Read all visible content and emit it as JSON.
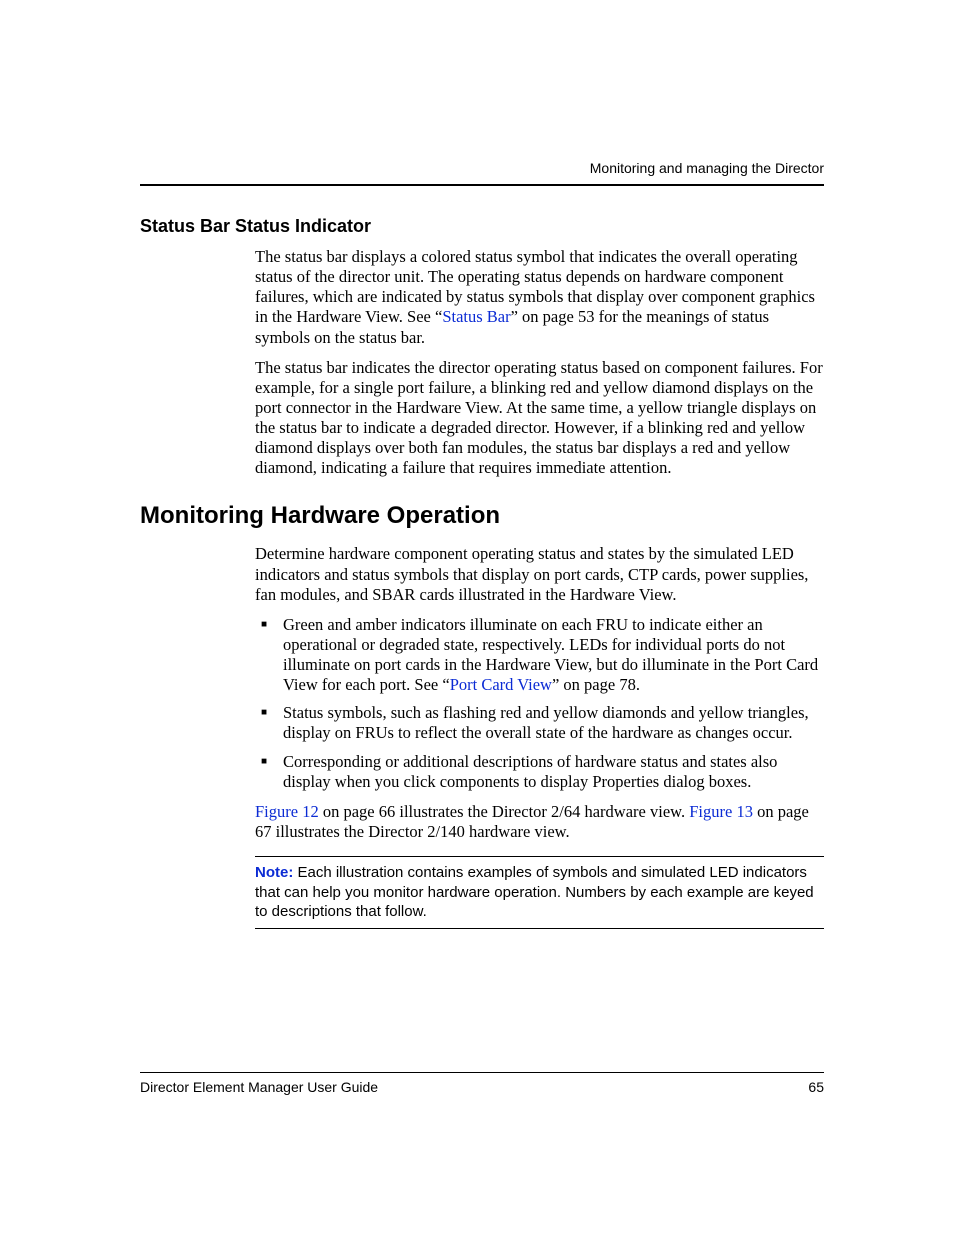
{
  "header": {
    "running": "Monitoring and managing the Director"
  },
  "section1": {
    "heading": "Status Bar Status Indicator",
    "p1a": "The status bar displays a colored status symbol that indicates the overall operating status of the director unit. The operating status depends on hardware component failures, which are indicated by status symbols that display over component graphics in the Hardware View. See “",
    "p1_link": "Status Bar",
    "p1b": "” on page 53 for the meanings of status symbols on the status bar.",
    "p2": "The status bar indicates the director operating status based on component failures. For example, for a single port failure, a blinking red and yellow diamond displays on the port connector in the Hardware View. At the same time, a yellow triangle displays on the status bar to indicate a degraded director. However, if a blinking red and yellow diamond displays over both fan modules, the status bar displays a red and yellow diamond, indicating a failure that requires immediate attention."
  },
  "section2": {
    "heading": "Monitoring Hardware Operation",
    "intro": "Determine hardware component operating status and states by the simulated LED indicators and status symbols that display on port cards, CTP cards, power supplies, fan modules, and SBAR cards illustrated in the Hardware View.",
    "bullets": [
      {
        "pre": "Green and amber indicators illuminate on each FRU to indicate either an operational or degraded state, respectively. LEDs for individual ports do not illuminate on port cards in the Hardware View, but do illuminate in the Port Card View for each port. See “",
        "link": "Port Card View",
        "post": "” on page 78."
      },
      {
        "pre": "Status symbols, such as flashing red and yellow diamonds and yellow triangles, display on FRUs to reflect the overall state of the hardware as changes occur.",
        "link": "",
        "post": ""
      },
      {
        "pre": "Corresponding or additional descriptions of hardware status and states also display when you click components to display Properties dialog boxes.",
        "link": "",
        "post": ""
      }
    ],
    "fig_para": {
      "link1": "Figure 12",
      "mid": " on page 66 illustrates the Director 2/64 hardware view. ",
      "link2": "Figure 13",
      "tail": " on page 67 illustrates the Director 2/140 hardware view."
    },
    "note": {
      "label": "Note:",
      "text": "  Each illustration contains examples of symbols and simulated LED indicators that can help you monitor hardware operation. Numbers by each example are keyed to descriptions that follow."
    }
  },
  "footer": {
    "title": "Director Element Manager User Guide",
    "page": "65"
  }
}
